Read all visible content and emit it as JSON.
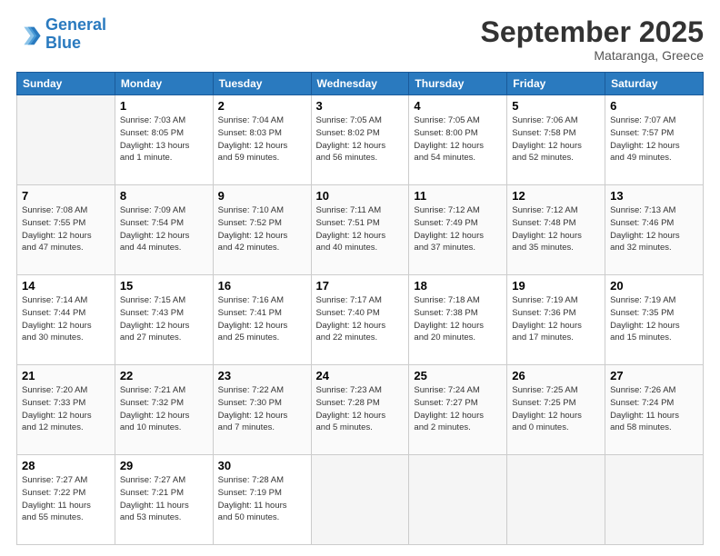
{
  "logo": {
    "line1": "General",
    "line2": "Blue"
  },
  "header": {
    "month": "September 2025",
    "location": "Mataranga, Greece"
  },
  "days_of_week": [
    "Sunday",
    "Monday",
    "Tuesday",
    "Wednesday",
    "Thursday",
    "Friday",
    "Saturday"
  ],
  "weeks": [
    [
      {
        "day": "",
        "info": ""
      },
      {
        "day": "1",
        "info": "Sunrise: 7:03 AM\nSunset: 8:05 PM\nDaylight: 13 hours\nand 1 minute."
      },
      {
        "day": "2",
        "info": "Sunrise: 7:04 AM\nSunset: 8:03 PM\nDaylight: 12 hours\nand 59 minutes."
      },
      {
        "day": "3",
        "info": "Sunrise: 7:05 AM\nSunset: 8:02 PM\nDaylight: 12 hours\nand 56 minutes."
      },
      {
        "day": "4",
        "info": "Sunrise: 7:05 AM\nSunset: 8:00 PM\nDaylight: 12 hours\nand 54 minutes."
      },
      {
        "day": "5",
        "info": "Sunrise: 7:06 AM\nSunset: 7:58 PM\nDaylight: 12 hours\nand 52 minutes."
      },
      {
        "day": "6",
        "info": "Sunrise: 7:07 AM\nSunset: 7:57 PM\nDaylight: 12 hours\nand 49 minutes."
      }
    ],
    [
      {
        "day": "7",
        "info": "Sunrise: 7:08 AM\nSunset: 7:55 PM\nDaylight: 12 hours\nand 47 minutes."
      },
      {
        "day": "8",
        "info": "Sunrise: 7:09 AM\nSunset: 7:54 PM\nDaylight: 12 hours\nand 44 minutes."
      },
      {
        "day": "9",
        "info": "Sunrise: 7:10 AM\nSunset: 7:52 PM\nDaylight: 12 hours\nand 42 minutes."
      },
      {
        "day": "10",
        "info": "Sunrise: 7:11 AM\nSunset: 7:51 PM\nDaylight: 12 hours\nand 40 minutes."
      },
      {
        "day": "11",
        "info": "Sunrise: 7:12 AM\nSunset: 7:49 PM\nDaylight: 12 hours\nand 37 minutes."
      },
      {
        "day": "12",
        "info": "Sunrise: 7:12 AM\nSunset: 7:48 PM\nDaylight: 12 hours\nand 35 minutes."
      },
      {
        "day": "13",
        "info": "Sunrise: 7:13 AM\nSunset: 7:46 PM\nDaylight: 12 hours\nand 32 minutes."
      }
    ],
    [
      {
        "day": "14",
        "info": "Sunrise: 7:14 AM\nSunset: 7:44 PM\nDaylight: 12 hours\nand 30 minutes."
      },
      {
        "day": "15",
        "info": "Sunrise: 7:15 AM\nSunset: 7:43 PM\nDaylight: 12 hours\nand 27 minutes."
      },
      {
        "day": "16",
        "info": "Sunrise: 7:16 AM\nSunset: 7:41 PM\nDaylight: 12 hours\nand 25 minutes."
      },
      {
        "day": "17",
        "info": "Sunrise: 7:17 AM\nSunset: 7:40 PM\nDaylight: 12 hours\nand 22 minutes."
      },
      {
        "day": "18",
        "info": "Sunrise: 7:18 AM\nSunset: 7:38 PM\nDaylight: 12 hours\nand 20 minutes."
      },
      {
        "day": "19",
        "info": "Sunrise: 7:19 AM\nSunset: 7:36 PM\nDaylight: 12 hours\nand 17 minutes."
      },
      {
        "day": "20",
        "info": "Sunrise: 7:19 AM\nSunset: 7:35 PM\nDaylight: 12 hours\nand 15 minutes."
      }
    ],
    [
      {
        "day": "21",
        "info": "Sunrise: 7:20 AM\nSunset: 7:33 PM\nDaylight: 12 hours\nand 12 minutes."
      },
      {
        "day": "22",
        "info": "Sunrise: 7:21 AM\nSunset: 7:32 PM\nDaylight: 12 hours\nand 10 minutes."
      },
      {
        "day": "23",
        "info": "Sunrise: 7:22 AM\nSunset: 7:30 PM\nDaylight: 12 hours\nand 7 minutes."
      },
      {
        "day": "24",
        "info": "Sunrise: 7:23 AM\nSunset: 7:28 PM\nDaylight: 12 hours\nand 5 minutes."
      },
      {
        "day": "25",
        "info": "Sunrise: 7:24 AM\nSunset: 7:27 PM\nDaylight: 12 hours\nand 2 minutes."
      },
      {
        "day": "26",
        "info": "Sunrise: 7:25 AM\nSunset: 7:25 PM\nDaylight: 12 hours\nand 0 minutes."
      },
      {
        "day": "27",
        "info": "Sunrise: 7:26 AM\nSunset: 7:24 PM\nDaylight: 11 hours\nand 58 minutes."
      }
    ],
    [
      {
        "day": "28",
        "info": "Sunrise: 7:27 AM\nSunset: 7:22 PM\nDaylight: 11 hours\nand 55 minutes."
      },
      {
        "day": "29",
        "info": "Sunrise: 7:27 AM\nSunset: 7:21 PM\nDaylight: 11 hours\nand 53 minutes."
      },
      {
        "day": "30",
        "info": "Sunrise: 7:28 AM\nSunset: 7:19 PM\nDaylight: 11 hours\nand 50 minutes."
      },
      {
        "day": "",
        "info": ""
      },
      {
        "day": "",
        "info": ""
      },
      {
        "day": "",
        "info": ""
      },
      {
        "day": "",
        "info": ""
      }
    ]
  ]
}
